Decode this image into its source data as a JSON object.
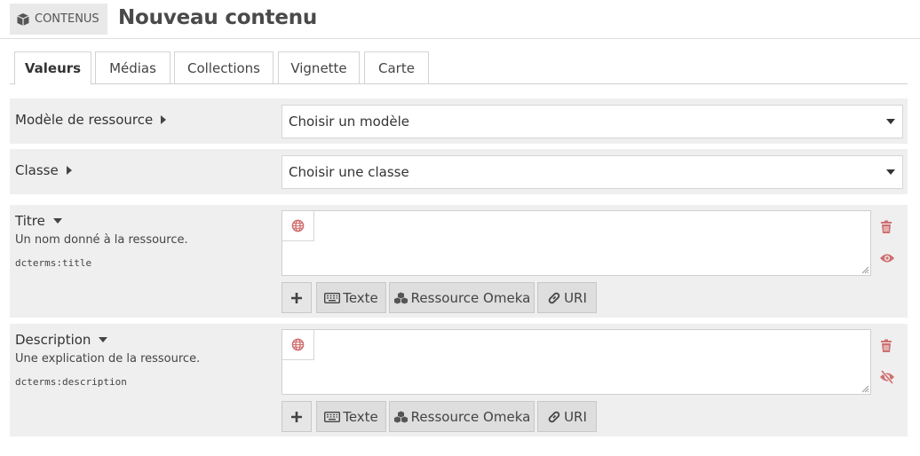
{
  "header": {
    "badge_label": "CONTENUS",
    "title": "Nouveau contenu"
  },
  "tabs": [
    {
      "label": "Valeurs",
      "active": true
    },
    {
      "label": "Médias"
    },
    {
      "label": "Collections"
    },
    {
      "label": "Vignette"
    },
    {
      "label": "Carte"
    }
  ],
  "template_field": {
    "label": "Modèle de ressource",
    "select_value": "Choisir un modèle"
  },
  "class_field": {
    "label": "Classe",
    "select_value": "Choisir une classe"
  },
  "properties": [
    {
      "label": "Titre",
      "description": "Un nom donné à la ressource.",
      "term": "dcterms:title",
      "visibility_icon": "eye-icon"
    },
    {
      "label": "Description",
      "description": "Une explication de la ressource.",
      "term": "dcterms:description",
      "visibility_icon": "eye-slash-icon"
    }
  ],
  "value_buttons": {
    "text": "Texte",
    "resource": "Ressource Omeka",
    "uri": "URI"
  },
  "colors": {
    "danger": "#d06f6f",
    "panel": "#efefef"
  }
}
